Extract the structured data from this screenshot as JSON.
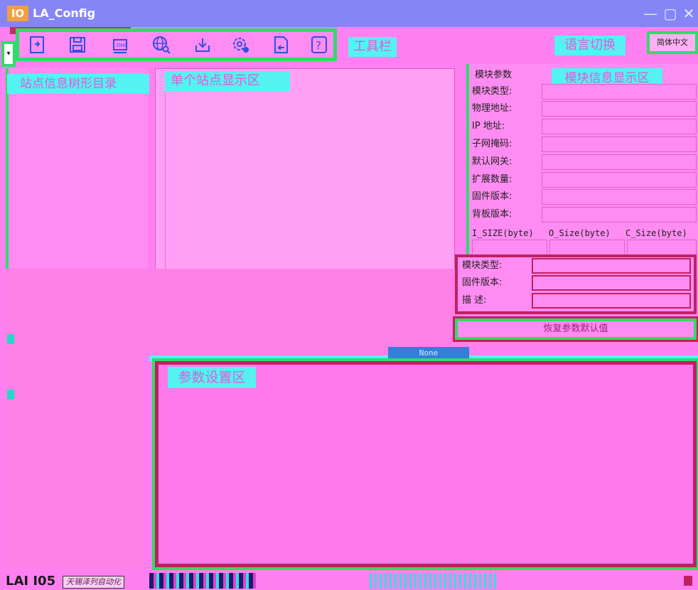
{
  "window": {
    "app_icon_text": "IO",
    "title": "LA_Config",
    "controls": {
      "minimize": "—",
      "maximize": "▢",
      "close": "✕"
    }
  },
  "toolbar": {
    "label": "工具栏",
    "icons": [
      "open-file-icon",
      "save-icon",
      "scan-device-icon",
      "network-search-icon",
      "download-icon",
      "settings-icon",
      "export-icon",
      "help-icon"
    ]
  },
  "language": {
    "label": "语言切换",
    "selected": "简体中文"
  },
  "tree": {
    "header": "站点信息树形目录"
  },
  "node": {
    "header": "单个站点显示区"
  },
  "module_info": {
    "title": "模块参数",
    "header": "模块信息显示区",
    "fields": [
      {
        "label": "模块类型:",
        "value": ""
      },
      {
        "label": "物理地址:",
        "value": ""
      },
      {
        "label": " IP 地址:",
        "value": ""
      },
      {
        "label": "子网掩码:",
        "value": ""
      },
      {
        "label": "默认网关:",
        "value": ""
      },
      {
        "label": "扩展数量:",
        "value": ""
      },
      {
        "label": "固件版本:",
        "value": ""
      },
      {
        "label": "背板版本:",
        "value": ""
      }
    ],
    "sizes": [
      {
        "label": "I_SIZE(byte)",
        "value": ""
      },
      {
        "label": "O_Size(byte)",
        "value": ""
      },
      {
        "label": "C_Size(byte)",
        "value": ""
      }
    ]
  },
  "sub_module": {
    "fields": [
      {
        "label": "模块类型:",
        "value": ""
      },
      {
        "label": "固件版本:",
        "value": ""
      },
      {
        "label": "描    述:",
        "value": ""
      }
    ],
    "restore_button": "恢复参数默认值"
  },
  "tab_none": "None",
  "params": {
    "header": "参数设置区"
  },
  "status": {
    "brand": "LAI I05",
    "text": "天锡泽列自动化"
  }
}
